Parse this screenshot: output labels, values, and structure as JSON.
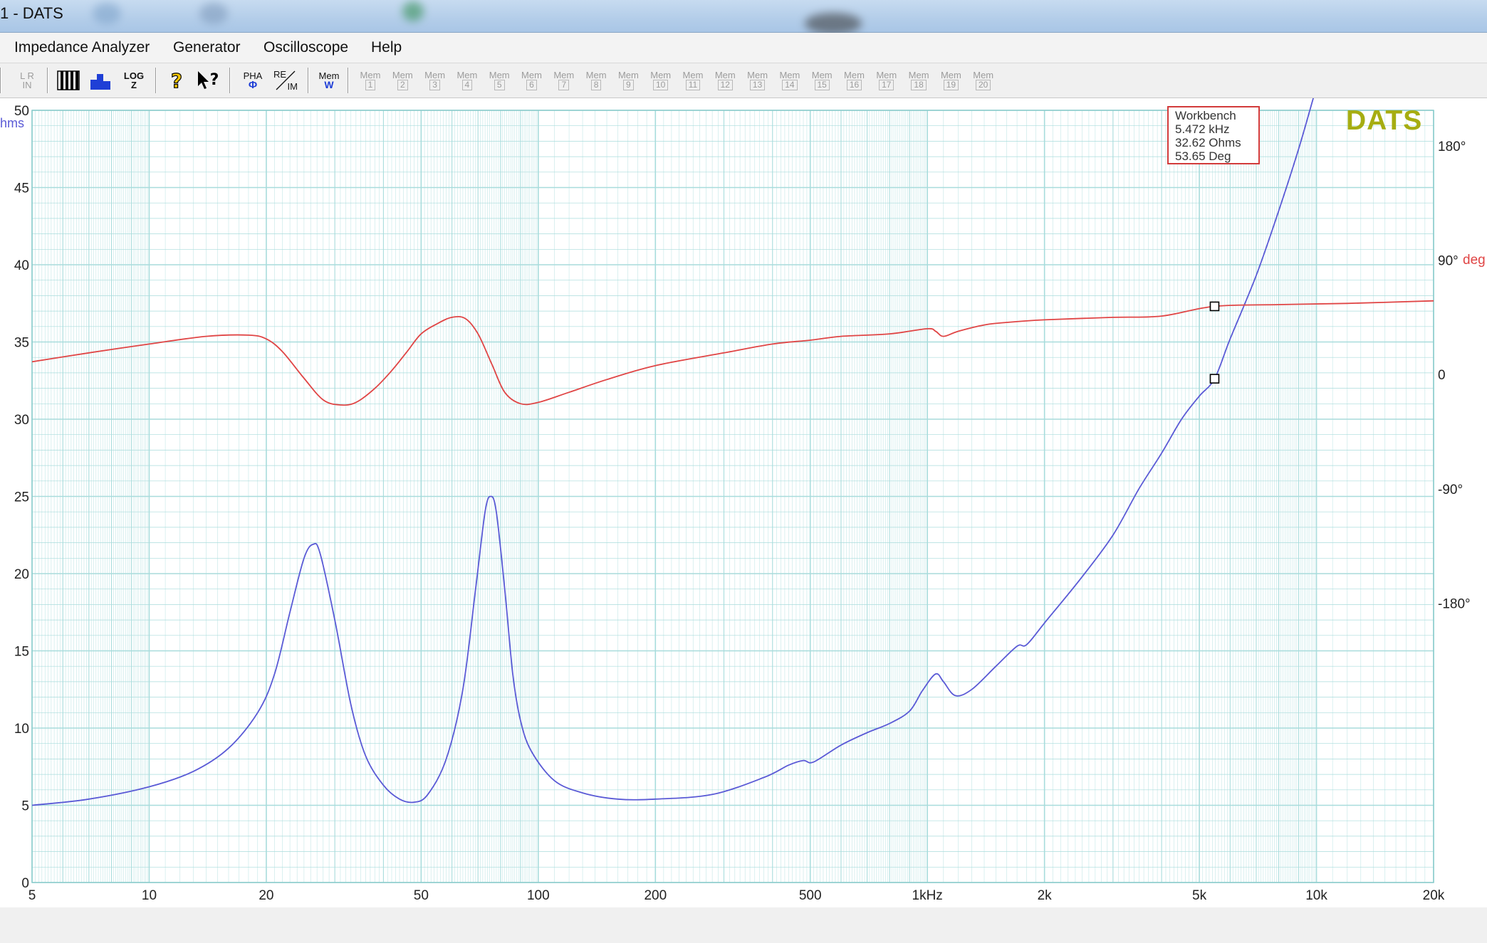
{
  "window": {
    "title": "1 - DATS"
  },
  "menu": {
    "items": [
      "Impedance Analyzer",
      "Generator",
      "Oscilloscope",
      "Help"
    ]
  },
  "toolbar": {
    "lr_top": "L R",
    "lr_bottom": "IN",
    "log_label": "LOG",
    "log_sub": "Z",
    "pha_label": "PHA",
    "pha_sub": "Φ",
    "reim_label": "RE",
    "reim_sub": "IM",
    "memw_label": "Mem",
    "memw_sub": "W",
    "mem_label": "Mem",
    "mem_slots": [
      "1",
      "2",
      "3",
      "4",
      "5",
      "6",
      "7",
      "8",
      "9",
      "10",
      "11",
      "12",
      "13",
      "14",
      "15",
      "16",
      "17",
      "18",
      "19",
      "20"
    ]
  },
  "logo": "DATS",
  "workbench": {
    "title": "Workbench",
    "freq": "5.472 kHz",
    "impedance": "32.62 Ohms",
    "phase": "53.65 Deg"
  },
  "colors": {
    "grid": "#a8dcdc",
    "impedance": "#5a5ad6",
    "phase": "#e04545",
    "marker_box": "#d23b3b",
    "logo": "#a6ad11"
  },
  "chart_data": {
    "type": "line",
    "x_scale": "log",
    "xlim": [
      5,
      20000
    ],
    "x_ticks": [
      5,
      10,
      20,
      50,
      100,
      200,
      500,
      1000,
      2000,
      5000,
      10000,
      20000
    ],
    "x_tick_labels": [
      "5",
      "10",
      "20",
      "50",
      "100",
      "200",
      "500",
      "1kHz",
      "2k",
      "5k",
      "10k",
      "20k"
    ],
    "ylabel": "hms",
    "ylim": [
      0,
      50
    ],
    "y_ticks": [
      0,
      5,
      10,
      15,
      20,
      25,
      30,
      35,
      40,
      45,
      50
    ],
    "y2label": "deg",
    "y2lim": [
      -400,
      208
    ],
    "y2_ticks": [
      180,
      90,
      0,
      -90,
      -180
    ],
    "y2_tick_labels": [
      "180°",
      "90°",
      "0",
      "-90°",
      "-180°"
    ],
    "grid": true,
    "series": [
      {
        "axis": "left",
        "color": "#5a5ad6",
        "points": [
          [
            5,
            5.0
          ],
          [
            7,
            5.4
          ],
          [
            10,
            6.2
          ],
          [
            13,
            7.2
          ],
          [
            16,
            8.7
          ],
          [
            19,
            11.0
          ],
          [
            21,
            13.5
          ],
          [
            23,
            17.5
          ],
          [
            25,
            21.0
          ],
          [
            26.4,
            21.9
          ],
          [
            27.5,
            21.3
          ],
          [
            30,
            17.0
          ],
          [
            33,
            11.5
          ],
          [
            36,
            8.2
          ],
          [
            40,
            6.3
          ],
          [
            44,
            5.4
          ],
          [
            48,
            5.2
          ],
          [
            52,
            5.7
          ],
          [
            58,
            8.0
          ],
          [
            64,
            12.5
          ],
          [
            69,
            19.0
          ],
          [
            73,
            24.0
          ],
          [
            75.5,
            25.0
          ],
          [
            78,
            24.0
          ],
          [
            82,
            19.0
          ],
          [
            86,
            13.5
          ],
          [
            90,
            10.5
          ],
          [
            96,
            8.5
          ],
          [
            110,
            6.6
          ],
          [
            130,
            5.8
          ],
          [
            160,
            5.4
          ],
          [
            200,
            5.4
          ],
          [
            280,
            5.7
          ],
          [
            380,
            6.8
          ],
          [
            440,
            7.6
          ],
          [
            480,
            7.9
          ],
          [
            510,
            7.8
          ],
          [
            600,
            8.9
          ],
          [
            700,
            9.7
          ],
          [
            800,
            10.3
          ],
          [
            900,
            11.1
          ],
          [
            970,
            12.4
          ],
          [
            1050,
            13.5
          ],
          [
            1100,
            13.0
          ],
          [
            1180,
            12.1
          ],
          [
            1300,
            12.5
          ],
          [
            1500,
            14.0
          ],
          [
            1700,
            15.3
          ],
          [
            1800,
            15.4
          ],
          [
            2000,
            16.8
          ],
          [
            2500,
            19.8
          ],
          [
            3000,
            22.5
          ],
          [
            3500,
            25.5
          ],
          [
            4000,
            27.8
          ],
          [
            4500,
            30.0
          ],
          [
            5000,
            31.5
          ],
          [
            5472,
            32.62
          ],
          [
            6000,
            35.2
          ],
          [
            7000,
            39.3
          ],
          [
            8000,
            43.5
          ],
          [
            9000,
            47.5
          ],
          [
            10000,
            51.5
          ],
          [
            11000,
            55.0
          ]
        ]
      },
      {
        "axis": "right",
        "color": "#e04545",
        "points": [
          [
            5,
            10
          ],
          [
            7,
            17
          ],
          [
            10,
            24
          ],
          [
            14,
            30
          ],
          [
            18,
            31
          ],
          [
            20,
            28
          ],
          [
            22,
            18
          ],
          [
            25,
            -3
          ],
          [
            28,
            -20
          ],
          [
            31,
            -24
          ],
          [
            34,
            -22
          ],
          [
            38,
            -11
          ],
          [
            42,
            3
          ],
          [
            46,
            18
          ],
          [
            50,
            32
          ],
          [
            55,
            40
          ],
          [
            60,
            45
          ],
          [
            65,
            44
          ],
          [
            70,
            32
          ],
          [
            76,
            8
          ],
          [
            82,
            -14
          ],
          [
            90,
            -23
          ],
          [
            100,
            -22
          ],
          [
            120,
            -14
          ],
          [
            150,
            -4
          ],
          [
            200,
            7
          ],
          [
            300,
            17
          ],
          [
            400,
            24
          ],
          [
            500,
            27
          ],
          [
            600,
            30
          ],
          [
            800,
            32
          ],
          [
            1000,
            36
          ],
          [
            1050,
            34
          ],
          [
            1100,
            30
          ],
          [
            1200,
            34
          ],
          [
            1400,
            39
          ],
          [
            1600,
            41
          ],
          [
            2000,
            43
          ],
          [
            3000,
            45
          ],
          [
            4000,
            46
          ],
          [
            5472,
            53.65
          ],
          [
            8000,
            55
          ],
          [
            12000,
            56
          ],
          [
            20000,
            58
          ]
        ]
      }
    ],
    "markers": [
      {
        "x": 5472,
        "y": 32.62,
        "axis": "left"
      },
      {
        "x": 5472,
        "y": 53.65,
        "axis": "right"
      }
    ]
  }
}
